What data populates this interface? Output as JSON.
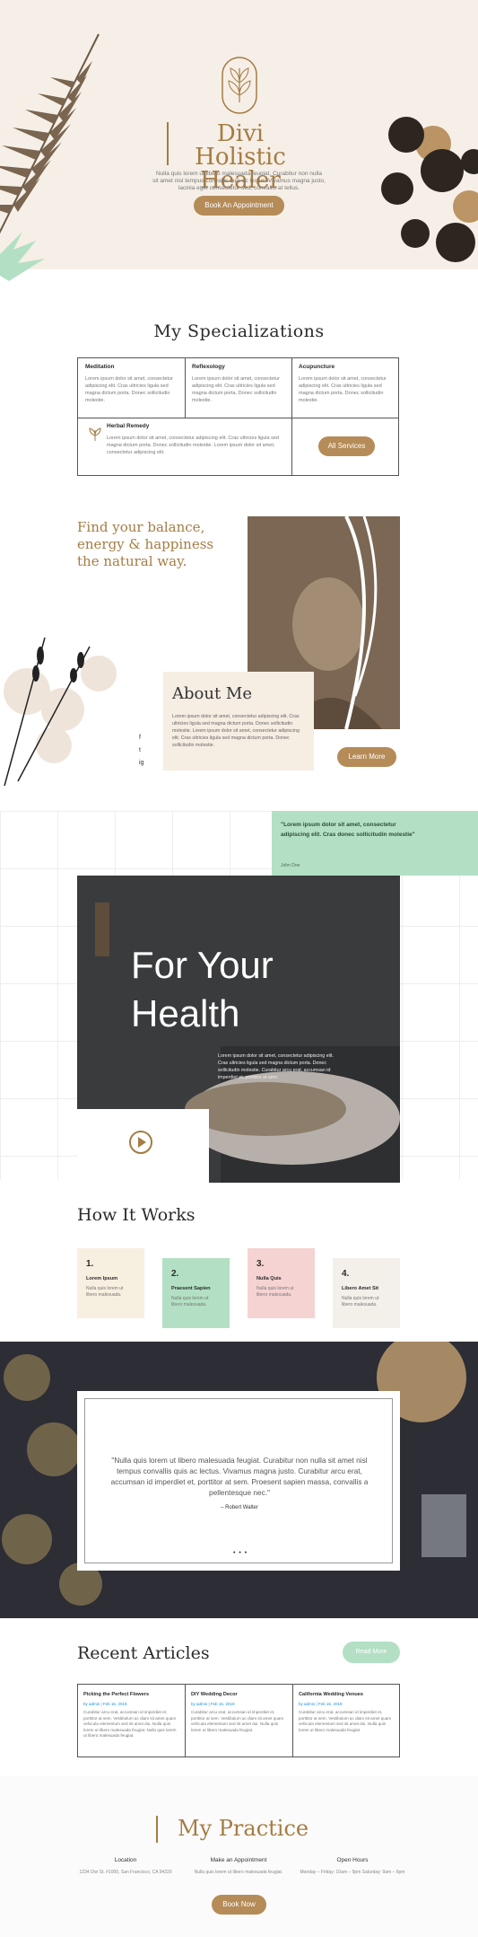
{
  "colors": {
    "brand": "#a57c43",
    "button": "#b58b57",
    "mint": "#b3e0c4",
    "pink": "#f5d3d2",
    "cream": "#f6efe7"
  },
  "hero": {
    "title_line1": "Divi Holistic",
    "title_line2": "Healer",
    "subtitle": "Nulla quis lorem ut libero malesuada feugiat. Curabitur non nulla sit amet nisl tempus convallis quis ac lectus. Vivamus magna justo, lacinia eget consectetur sed, convallis at tellus.",
    "button": "Book An Appointment"
  },
  "specializations": {
    "title": "My Specializations",
    "items": [
      {
        "title": "Meditation",
        "text": "Lorem ipsum dolor sit amet, consectetur adipiscing elit. Cras ultricies ligula sed magna dictum porta. Donec sollicitudin molestie."
      },
      {
        "title": "Reflexology",
        "text": "Lorem ipsum dolor sit amet, consectetur adipiscing elit. Cras ultricies ligula sed magna dictum porta. Donec sollicitudin molestie."
      },
      {
        "title": "Acupuncture",
        "text": "Lorem ipsum dolor sit amet, consectetur adipiscing elit. Cras ultricies ligula sed magna dictum porta. Donec sollicitudin molestie."
      },
      {
        "title": "Herbal Remedy",
        "text": "Lorem ipsum dolor sit amet, consectetur adipiscing elit. Cras ultricies ligula sed magna dictum porta. Donec sollicitudin molestie. Lorem ipsum dolor sit amet, consectetur adipiscing elit."
      }
    ],
    "button": "All Services"
  },
  "about": {
    "tagline": "Find your balance, energy & happiness the natural way.",
    "title": "About Me",
    "text": "Lorem ipsum dolor sit amet, consectetur adipiscing elit. Cras ultricies ligula sed magna dictum porta. Donec sollicitudin molestie. Lorem ipsum dolor sit amet, consectetur adipiscing elit. Cras ultricies ligula sed magna dictum porta. Donec sollicitudin molestie.",
    "button": "Learn More",
    "social": [
      "f",
      "t",
      "ig"
    ]
  },
  "health": {
    "quote": "\"Lorem ipsum dolor sit amet, consectetur adipiscing elit. Cras donec sollicitudin molestie\"",
    "quote_author": "John Doe",
    "title_line1": "For Your",
    "title_line2": "Health",
    "text": "Lorem ipsum dolor sit amet, consectetur adipiscing elit. Cras ultricies ligula sed magna dictum porta. Donec sollicitudin molestie. Curabitur arcu erat, accumsan id imperdiet et, porttitor at sem."
  },
  "how": {
    "title": "How It Works",
    "steps": [
      {
        "num": "1.",
        "title": "Lorem Ipsum",
        "text": "Nulla quis lorem ut libero malesuada."
      },
      {
        "num": "2.",
        "title": "Praesent Sapien",
        "text": "Nulla quis lorem ut libero malesuada."
      },
      {
        "num": "3.",
        "title": "Nulla Quis",
        "text": "Nulla quis lorem ut libero malesuada."
      },
      {
        "num": "4.",
        "title": "Libero Amet Sit",
        "text": "Nulla quis lorem ut libero malesuada."
      }
    ]
  },
  "testimonial": {
    "text": "\"Nulla quis lorem ut libero malesuada feugiat. Curabitur non nulla sit amet nisl tempus convallis quis ac lectus. Vivamus magna justo. Curabitur arcu erat, accumsan id imperdiet et, porttitor at sem. Proesent sapien massa, convallis a pellentesque nec.\"",
    "author": "– Robert Walter",
    "dots": "• • •"
  },
  "articles": {
    "title": "Recent Articles",
    "button": "Read More",
    "items": [
      {
        "title": "Picking the Perfect Flowers",
        "meta": "by admin | Feb 16, 2019",
        "text": "Curabitur arcu erat, accumsan id imperdiet et, porttitor at sem. Vestibulum ac diam sit amet quam vehicula elementum sed sit amet dui. Nulla quis lorem ut libero malesuada feugiat. Nulla quis lorem ut libero malesuada feugiat."
      },
      {
        "title": "DIY Wedding Decor",
        "meta": "by admin | Feb 16, 2019",
        "text": "Curabitur arcu erat, accumsan id imperdiet et, porttitor at sem. Vestibulum ac diam sit amet quam vehicula elementum sed sit amet dui. Nulla quis lorem ut libero malesuada feugiat."
      },
      {
        "title": "California Wedding Venues",
        "meta": "by admin | Feb 16, 2019",
        "text": "Curabitur arcu erat, accumsan id imperdiet et, porttitor at sem. Vestibulum ac diam sit amet quam vehicula elementum sed sit amet dui. Nulla quis lorem ut libero malesuada feugiat."
      }
    ]
  },
  "practice": {
    "title": "My Practice",
    "location_title": "Location",
    "location_text": "1234 Divi St. #1000, San Francisco, CA 94220",
    "appointment_title": "Make an Appointment",
    "appointment_text": "Nulla quis lorem ut libero malesuada feugiat.",
    "hours_title": "Open Hours",
    "hours_text": "Monday – Friday: 10am – 9pm Saturday: 9am – 6pm",
    "button": "Book Now"
  }
}
